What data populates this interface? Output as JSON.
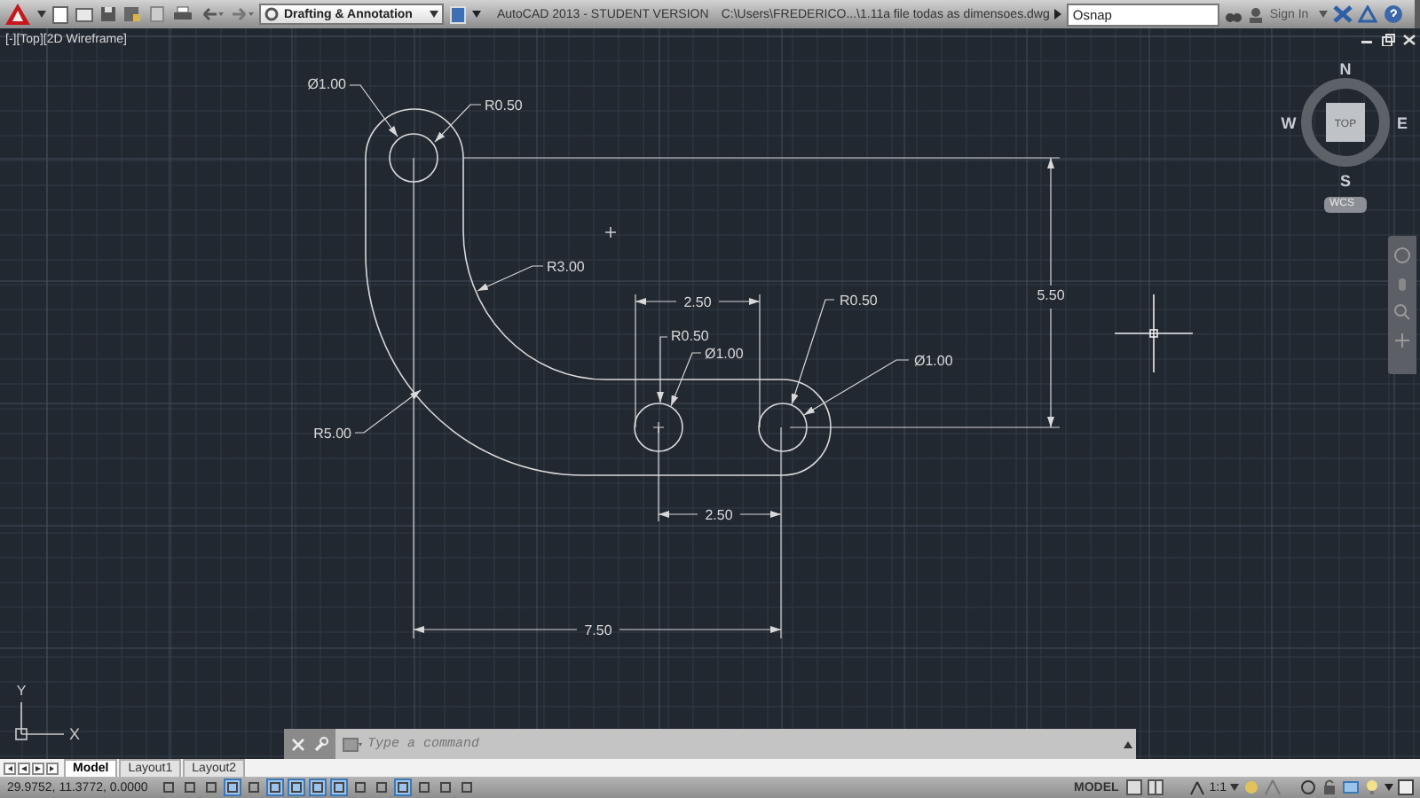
{
  "title_bar": {
    "workspace": "Drafting & Annotation",
    "app_title": "AutoCAD 2013 - STUDENT VERSION",
    "file_path": "C:\\Users\\FREDERICO...\\1.11a file todas as dimensoes.dwg",
    "search": {
      "value": "Osnap"
    },
    "sign_in": "Sign In"
  },
  "viewport": {
    "label": "[-][Top][2D Wireframe]"
  },
  "drawing": {
    "annotations": [
      {
        "kind": "leader",
        "text": "Ø1.00"
      },
      {
        "kind": "leader",
        "text": "R0.50"
      },
      {
        "kind": "leader",
        "text": "R3.00"
      },
      {
        "kind": "linear",
        "text": "5.50"
      },
      {
        "kind": "linear",
        "text": "2.50"
      },
      {
        "kind": "leader",
        "text": "R0.50"
      },
      {
        "kind": "leader",
        "text": "R0.50"
      },
      {
        "kind": "leader",
        "text": "Ø1.00"
      },
      {
        "kind": "leader",
        "text": "Ø1.00"
      },
      {
        "kind": "leader",
        "text": "R5.00"
      },
      {
        "kind": "linear",
        "text": "2.50"
      },
      {
        "kind": "linear",
        "text": "7.50"
      }
    ]
  },
  "viewcube": {
    "north": "N",
    "west": "W",
    "face": "TOP",
    "east": "E",
    "south": "S",
    "coordinate_system": "WCS"
  },
  "ucs_icon": {
    "y_axis": "Y",
    "x_axis": "X"
  },
  "command_line": {
    "placeholder": "Type a command"
  },
  "layout_tabs": [
    {
      "label": "Model",
      "selected": true
    },
    {
      "label": "Layout1",
      "selected": false
    },
    {
      "label": "Layout2",
      "selected": false
    }
  ],
  "status_bar": {
    "coordinates": "29.9752, 11.3772, 0.0000",
    "toggles": [
      {
        "on": false
      },
      {
        "on": false
      },
      {
        "on": false
      },
      {
        "on": true
      },
      {
        "on": false
      },
      {
        "on": true
      },
      {
        "on": true
      },
      {
        "on": true
      },
      {
        "on": true
      },
      {
        "on": false
      },
      {
        "on": false
      },
      {
        "on": true
      },
      {
        "on": false
      },
      {
        "on": false
      },
      {
        "on": false
      }
    ],
    "space": "MODEL",
    "scale": "1:1"
  }
}
